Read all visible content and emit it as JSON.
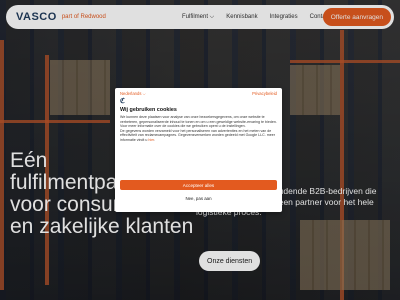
{
  "header": {
    "logo": "VASCO",
    "logo_sub": "part of Redwood",
    "nav": [
      "Fulfilment ⌵",
      "Kennisbank",
      "Integraties",
      "Contact"
    ],
    "cta": "Offerte aanvragen"
  },
  "hero": {
    "title_lines": [
      "Eén",
      "fulfilmentpartner",
      "voor consumenten",
      "en zakelijke klanten"
    ],
    "paragraph": "partij voor voorraadhoudende B2B-bedrijven die behoefte hebben aan een partner voor het hele logistieke proces.",
    "button": "Onze diensten"
  },
  "cookie": {
    "language": "Nederlands ⌵",
    "privacy": "Privacybeleid",
    "title": "Wij gebruiken cookies",
    "text1": "We kunnen deze plaatsen voor analyse van onze bezoekersgegevens, om onze website te verbeteren, gepersonaliseerde inhoud te tonen en om u een geweldige website-ervaring te bieden. Voor meer informatie over de cookies die we gebruiken opent u de instellingen.",
    "text2": "De gegevens worden verzameld voor het personaliseren van advertenties en het meten van de effectiviteit van reclamecampagnes. Gegevensverwerken worden gedeeld met Google LLC. meer informatie vindt u",
    "link": "hier",
    "accept": "Accepteer alles",
    "reject": "Nee, pas aan"
  }
}
